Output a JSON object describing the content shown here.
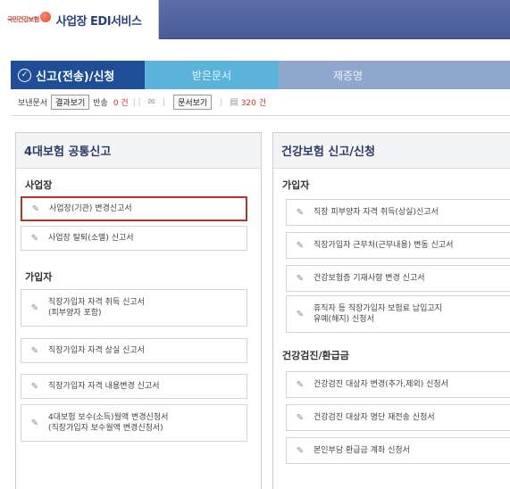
{
  "header": {
    "logo_text": "국민건강보험",
    "title": "사업장 EDI서비스"
  },
  "tabs": [
    {
      "label": "신고(전송)/신청"
    },
    {
      "label": "받은문서"
    },
    {
      "label": "제증명"
    }
  ],
  "toolbar": {
    "sent_label": "보낸문서",
    "result_button": "결과보기",
    "return_label": "반송",
    "return_count": "0 건",
    "doc_button": "문서보기",
    "doc_count": "320 건"
  },
  "left_panel": {
    "title": "4대보험 공통신고",
    "sections": [
      {
        "title": "사업장",
        "items": [
          "사업장(기관) 변경신고서",
          "사업장 탈퇴(소멸) 신고서"
        ]
      },
      {
        "title": "가입자",
        "items": [
          "직장가입자 자격 취득 신고서\n(피부양자 포함)",
          "직장가입자 자격 상실 신고서",
          "직장가입자 자격 내용변경 신고서",
          "4대보험 보수(소득)월액 변경신청서\n(직장가입자 보수월액 변경신청서)"
        ]
      }
    ]
  },
  "right_panel": {
    "title": "건강보험 신고/신청",
    "sections": [
      {
        "title": "가입자",
        "items": [
          "직장 피부양자 자격 취득(상실)신고서",
          "직장가입자 근무처(근무내용) 변동 신고서",
          "건강보험증 기재사항 변경 신고서",
          "휴직자 등 직장가입자 보험료 납입고지\n유예(해지) 신청서"
        ]
      },
      {
        "title": "건강검진/환급금",
        "items": [
          "건강검진 대상자 변경(추가,제외) 신청서",
          "건강검진 대상자 명단 재전송 신청서",
          "본인부담 환급금 계좌 신청서"
        ]
      }
    ]
  },
  "icons": {
    "form": "document-edit-icon",
    "check": "check-circle-icon",
    "mail": "envelope-icon"
  }
}
